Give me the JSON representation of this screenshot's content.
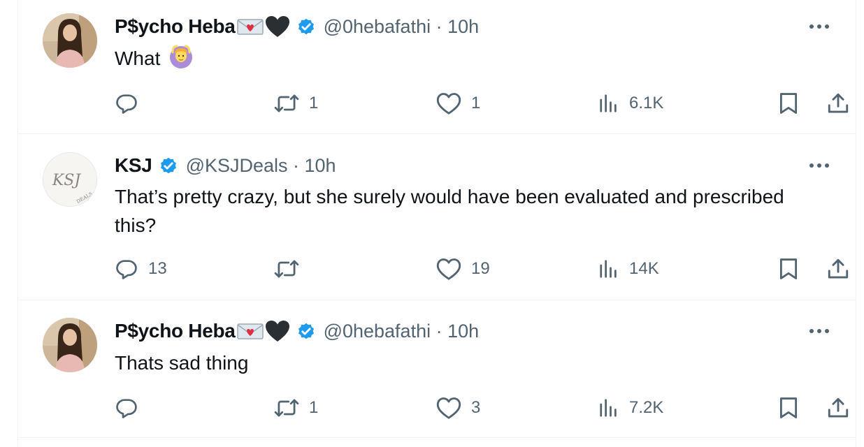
{
  "colors": {
    "text_primary": "#0f1419",
    "text_secondary": "#536471",
    "verified_blue": "#1d9bf0",
    "divider": "#eff3f4"
  },
  "tweets": [
    {
      "display_name": "P$ychο Heba",
      "name_emojis": [
        "love-letter-icon",
        "black-heart-icon"
      ],
      "verified": true,
      "handle": "@0hebafathi",
      "time": "10h",
      "meta": "@0hebafathi · 10h",
      "text": "What",
      "text_emoji": "woman-gesturing-ok-icon",
      "avatar": "photo-avatar",
      "replies": "",
      "reposts": "1",
      "likes": "1",
      "views": "6.1K"
    },
    {
      "display_name": "KSJ",
      "name_emojis": [],
      "verified": true,
      "handle": "@KSJDeals",
      "time": "10h",
      "meta": "@KSJDeals · 10h",
      "text": "That’s pretty crazy, but she surely would have been evaluated and prescribed this?",
      "avatar": "logo-avatar",
      "avatar_logo_text": "KSJ",
      "avatar_logo_sub": "DEALS",
      "replies": "13",
      "reposts": "",
      "likes": "19",
      "views": "14K"
    },
    {
      "display_name": "P$ychο Heba",
      "name_emojis": [
        "love-letter-icon",
        "black-heart-icon"
      ],
      "verified": true,
      "handle": "@0hebafathi",
      "time": "10h",
      "meta": "@0hebafathi · 10h",
      "text": "Thats sad thing",
      "avatar": "photo-avatar",
      "replies": "",
      "reposts": "1",
      "likes": "3",
      "views": "7.2K"
    }
  ],
  "icons": {
    "reply": "reply-icon",
    "repost": "repost-icon",
    "like": "like-icon",
    "views": "views-icon",
    "bookmark": "bookmark-icon",
    "share": "share-icon",
    "more": "more-icon",
    "verified": "verified-badge-icon"
  }
}
